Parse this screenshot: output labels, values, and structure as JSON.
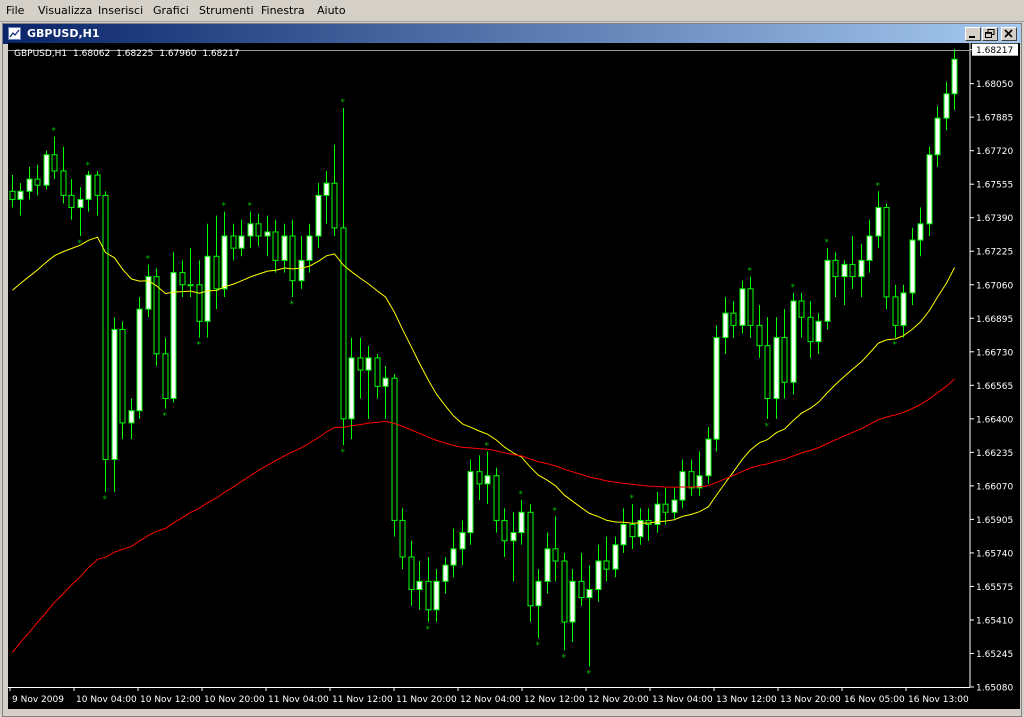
{
  "menu": [
    "File",
    "Visualizza",
    "Inserisci",
    "Grafici",
    "Strumenti",
    "Finestra",
    "Aiuto"
  ],
  "window": {
    "title": "GBPUSD,H1"
  },
  "chart_header": {
    "symbol": "GBPUSD,H1",
    "open": "1.68062",
    "high": "1.68225",
    "low": "1.67960",
    "close": "1.68217"
  },
  "chart_data": {
    "type": "candlestick",
    "symbol": "GBPUSD",
    "timeframe": "H1",
    "y_ticks": [
      "1.68217",
      "1.68050",
      "1.67885",
      "1.67720",
      "1.67555",
      "1.67390",
      "1.67225",
      "1.67060",
      "1.66895",
      "1.66730",
      "1.66565",
      "1.66400",
      "1.66235",
      "1.66070",
      "1.65905",
      "1.65740",
      "1.65575",
      "1.65410",
      "1.65245",
      "1.65080"
    ],
    "x_ticks": [
      "9 Nov 2009",
      "10 Nov 04:00",
      "10 Nov 12:00",
      "10 Nov 20:00",
      "11 Nov 04:00",
      "11 Nov 12:00",
      "11 Nov 20:00",
      "12 Nov 04:00",
      "12 Nov 12:00",
      "12 Nov 20:00",
      "13 Nov 04:00",
      "13 Nov 12:00",
      "13 Nov 20:00",
      "16 Nov 05:00",
      "16 Nov 13:00"
    ],
    "current_price": 1.68217,
    "ylim": [
      1.6508,
      1.6825
    ],
    "colors": {
      "background": "#000000",
      "bull_candle": "#ffffff",
      "bear_candle": "#000000",
      "candle_outline": "#00ff00",
      "fractal": "#00c000",
      "ma_yellow": "#ffff00",
      "ma_red": "#ff0000",
      "axis_text": "#ffffff",
      "price_line": "#a0a0a0"
    },
    "candles": [
      [
        1.6752,
        1.676,
        1.6744,
        1.6748
      ],
      [
        1.6748,
        1.6756,
        1.674,
        1.6752
      ],
      [
        1.6752,
        1.6764,
        1.6748,
        1.6758
      ],
      [
        1.6758,
        1.6765,
        1.675,
        1.6755
      ],
      [
        1.6755,
        1.6772,
        1.6753,
        1.677
      ],
      [
        1.677,
        1.6779,
        1.6758,
        1.6762
      ],
      [
        1.6762,
        1.6774,
        1.6746,
        1.675
      ],
      [
        1.675,
        1.6758,
        1.6738,
        1.6744
      ],
      [
        1.6744,
        1.6754,
        1.673,
        1.6748
      ],
      [
        1.6748,
        1.6762,
        1.6742,
        1.676
      ],
      [
        1.676,
        1.6762,
        1.674,
        1.675
      ],
      [
        1.675,
        1.6752,
        1.6604,
        1.662
      ],
      [
        1.662,
        1.669,
        1.6604,
        1.6684
      ],
      [
        1.6684,
        1.6688,
        1.663,
        1.6638
      ],
      [
        1.6638,
        1.665,
        1.663,
        1.6644
      ],
      [
        1.6644,
        1.67,
        1.664,
        1.6694
      ],
      [
        1.6694,
        1.6716,
        1.669,
        1.671
      ],
      [
        1.671,
        1.6714,
        1.6666,
        1.6672
      ],
      [
        1.6672,
        1.668,
        1.6645,
        1.665
      ],
      [
        1.665,
        1.6722,
        1.6648,
        1.6712
      ],
      [
        1.6712,
        1.6718,
        1.67,
        1.6706
      ],
      [
        1.6706,
        1.6724,
        1.67,
        1.6706
      ],
      [
        1.6706,
        1.6718,
        1.668,
        1.6688
      ],
      [
        1.6688,
        1.6736,
        1.668,
        1.672
      ],
      [
        1.672,
        1.674,
        1.6694,
        1.6704
      ],
      [
        1.6704,
        1.6742,
        1.67,
        1.673
      ],
      [
        1.673,
        1.6736,
        1.6718,
        1.6724
      ],
      [
        1.6724,
        1.6738,
        1.672,
        1.673
      ],
      [
        1.673,
        1.6742,
        1.6724,
        1.6736
      ],
      [
        1.6736,
        1.6741,
        1.6725,
        1.673
      ],
      [
        1.673,
        1.674,
        1.672,
        1.6732
      ],
      [
        1.6732,
        1.6738,
        1.6712,
        1.6718
      ],
      [
        1.6718,
        1.6736,
        1.6712,
        1.673
      ],
      [
        1.673,
        1.6738,
        1.67,
        1.6708
      ],
      [
        1.6708,
        1.673,
        1.6704,
        1.6718
      ],
      [
        1.6718,
        1.6736,
        1.6712,
        1.673
      ],
      [
        1.673,
        1.6756,
        1.6724,
        1.675
      ],
      [
        1.675,
        1.6762,
        1.6736,
        1.6756
      ],
      [
        1.6756,
        1.6775,
        1.673,
        1.6734
      ],
      [
        1.6734,
        1.6793,
        1.6627,
        1.664
      ],
      [
        1.664,
        1.668,
        1.663,
        1.667
      ],
      [
        1.667,
        1.668,
        1.665,
        1.6664
      ],
      [
        1.6664,
        1.6676,
        1.664,
        1.667
      ],
      [
        1.667,
        1.6672,
        1.665,
        1.6656
      ],
      [
        1.6656,
        1.6666,
        1.664,
        1.666
      ],
      [
        1.666,
        1.6662,
        1.6582,
        1.659
      ],
      [
        1.659,
        1.6596,
        1.6566,
        1.6572
      ],
      [
        1.6572,
        1.658,
        1.6548,
        1.6556
      ],
      [
        1.6556,
        1.657,
        1.6546,
        1.656
      ],
      [
        1.656,
        1.6572,
        1.654,
        1.6546
      ],
      [
        1.6546,
        1.6566,
        1.654,
        1.656
      ],
      [
        1.656,
        1.6572,
        1.6554,
        1.6568
      ],
      [
        1.6568,
        1.6586,
        1.6562,
        1.6576
      ],
      [
        1.6576,
        1.659,
        1.6568,
        1.6584
      ],
      [
        1.6584,
        1.662,
        1.6578,
        1.6614
      ],
      [
        1.6614,
        1.6622,
        1.66,
        1.6608
      ],
      [
        1.6608,
        1.6624,
        1.6598,
        1.6612
      ],
      [
        1.6612,
        1.6616,
        1.6584,
        1.659
      ],
      [
        1.659,
        1.6596,
        1.6572,
        1.658
      ],
      [
        1.658,
        1.6594,
        1.656,
        1.6584
      ],
      [
        1.6584,
        1.66,
        1.6578,
        1.6594
      ],
      [
        1.6594,
        1.6598,
        1.654,
        1.6548
      ],
      [
        1.6548,
        1.6566,
        1.6532,
        1.656
      ],
      [
        1.656,
        1.6584,
        1.6554,
        1.6576
      ],
      [
        1.6576,
        1.6592,
        1.656,
        1.657
      ],
      [
        1.657,
        1.6574,
        1.6526,
        1.654
      ],
      [
        1.654,
        1.6566,
        1.653,
        1.656
      ],
      [
        1.656,
        1.6574,
        1.6548,
        1.6552
      ],
      [
        1.6552,
        1.6568,
        1.6518,
        1.6556
      ],
      [
        1.6556,
        1.6578,
        1.655,
        1.657
      ],
      [
        1.657,
        1.6582,
        1.656,
        1.6566
      ],
      [
        1.6566,
        1.6582,
        1.6562,
        1.6578
      ],
      [
        1.6578,
        1.6596,
        1.6574,
        1.6588
      ],
      [
        1.6588,
        1.6598,
        1.6576,
        1.6582
      ],
      [
        1.6582,
        1.6596,
        1.6578,
        1.659
      ],
      [
        1.659,
        1.6596,
        1.658,
        1.6588
      ],
      [
        1.6588,
        1.6604,
        1.6584,
        1.6598
      ],
      [
        1.6598,
        1.6606,
        1.6588,
        1.6594
      ],
      [
        1.6594,
        1.6606,
        1.659,
        1.66
      ],
      [
        1.66,
        1.662,
        1.6596,
        1.6614
      ],
      [
        1.6614,
        1.662,
        1.6602,
        1.6606
      ],
      [
        1.6606,
        1.6624,
        1.6602,
        1.6612
      ],
      [
        1.6612,
        1.6636,
        1.6608,
        1.663
      ],
      [
        1.663,
        1.6686,
        1.6624,
        1.668
      ],
      [
        1.668,
        1.67,
        1.6672,
        1.6692
      ],
      [
        1.6692,
        1.6698,
        1.668,
        1.6686
      ],
      [
        1.6686,
        1.6708,
        1.6682,
        1.6704
      ],
      [
        1.6704,
        1.671,
        1.668,
        1.6686
      ],
      [
        1.6686,
        1.6696,
        1.667,
        1.6676
      ],
      [
        1.6676,
        1.669,
        1.664,
        1.665
      ],
      [
        1.665,
        1.669,
        1.664,
        1.668
      ],
      [
        1.668,
        1.6694,
        1.665,
        1.6658
      ],
      [
        1.6658,
        1.6702,
        1.6652,
        1.6698
      ],
      [
        1.6698,
        1.6702,
        1.668,
        1.669
      ],
      [
        1.669,
        1.6698,
        1.667,
        1.6678
      ],
      [
        1.6678,
        1.6692,
        1.6672,
        1.6688
      ],
      [
        1.6688,
        1.6724,
        1.6684,
        1.6718
      ],
      [
        1.6718,
        1.6722,
        1.67,
        1.671
      ],
      [
        1.671,
        1.6718,
        1.6696,
        1.6716
      ],
      [
        1.6716,
        1.673,
        1.6704,
        1.671
      ],
      [
        1.671,
        1.6726,
        1.67,
        1.6718
      ],
      [
        1.6718,
        1.6738,
        1.6712,
        1.673
      ],
      [
        1.673,
        1.6752,
        1.6724,
        1.6744
      ],
      [
        1.6744,
        1.6746,
        1.6694,
        1.67
      ],
      [
        1.67,
        1.6706,
        1.668,
        1.6686
      ],
      [
        1.6686,
        1.6706,
        1.668,
        1.6702
      ],
      [
        1.6702,
        1.6734,
        1.6696,
        1.6728
      ],
      [
        1.6728,
        1.6744,
        1.672,
        1.6736
      ],
      [
        1.6736,
        1.6774,
        1.673,
        1.677
      ],
      [
        1.677,
        1.6794,
        1.6764,
        1.6788
      ],
      [
        1.6788,
        1.6806,
        1.6782,
        1.68
      ],
      [
        1.68,
        1.6822,
        1.6792,
        1.6817
      ]
    ]
  }
}
